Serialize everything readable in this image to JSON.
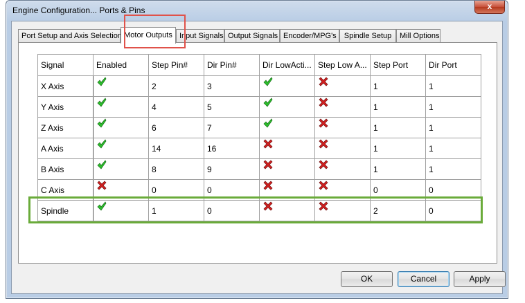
{
  "window": {
    "title": "Engine Configuration... Ports & Pins",
    "close_glyph": "x"
  },
  "tabs": [
    {
      "label": "Port Setup and Axis Selection",
      "active": false
    },
    {
      "label": "Motor Outputs",
      "active": true
    },
    {
      "label": "Input Signals",
      "active": false
    },
    {
      "label": "Output Signals",
      "active": false
    },
    {
      "label": "Encoder/MPG's",
      "active": false
    },
    {
      "label": "Spindle Setup",
      "active": false
    },
    {
      "label": "Mill Options",
      "active": false
    }
  ],
  "table": {
    "columns": [
      "Signal",
      "Enabled",
      "Step Pin#",
      "Dir Pin#",
      "Dir LowActi...",
      "Step Low A...",
      "Step Port",
      "Dir Port"
    ],
    "rows": [
      {
        "signal": "X Axis",
        "enabled": "check",
        "step_pin": "2",
        "dir_pin": "3",
        "dir_low_active": "check",
        "step_low_active": "cross",
        "step_port": "1",
        "dir_port": "1"
      },
      {
        "signal": "Y Axis",
        "enabled": "check",
        "step_pin": "4",
        "dir_pin": "5",
        "dir_low_active": "check",
        "step_low_active": "cross",
        "step_port": "1",
        "dir_port": "1"
      },
      {
        "signal": "Z Axis",
        "enabled": "check",
        "step_pin": "6",
        "dir_pin": "7",
        "dir_low_active": "check",
        "step_low_active": "cross",
        "step_port": "1",
        "dir_port": "1"
      },
      {
        "signal": "A Axis",
        "enabled": "check",
        "step_pin": "14",
        "dir_pin": "16",
        "dir_low_active": "cross",
        "step_low_active": "cross",
        "step_port": "1",
        "dir_port": "1"
      },
      {
        "signal": "B Axis",
        "enabled": "check",
        "step_pin": "8",
        "dir_pin": "9",
        "dir_low_active": "cross",
        "step_low_active": "cross",
        "step_port": "1",
        "dir_port": "1"
      },
      {
        "signal": "C Axis",
        "enabled": "cross",
        "step_pin": "0",
        "dir_pin": "0",
        "dir_low_active": "cross",
        "step_low_active": "cross",
        "step_port": "0",
        "dir_port": "0"
      },
      {
        "signal": "Spindle",
        "enabled": "check",
        "step_pin": "1",
        "dir_pin": "0",
        "dir_low_active": "cross",
        "step_low_active": "cross",
        "step_port": "2",
        "dir_port": "0"
      }
    ]
  },
  "buttons": {
    "ok": "OK",
    "cancel": "Cancel",
    "apply": "Apply"
  },
  "colors": {
    "check": "#2bbf2b",
    "cross": "#d42020",
    "highlight_tab": "#e0524a",
    "highlight_row": "#6aab3a"
  }
}
